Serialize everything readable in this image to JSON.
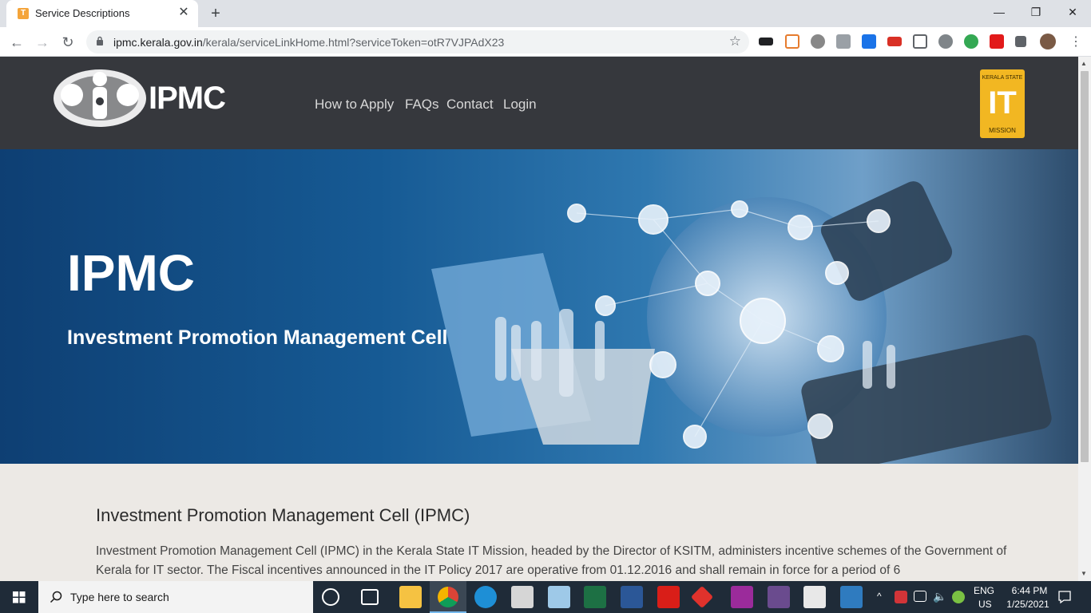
{
  "browser": {
    "tab_title": "Service Descriptions",
    "tab_favicon_letter": "T",
    "tab_close": "✕",
    "new_tab": "+",
    "minimize": "—",
    "restore": "❐",
    "close": "✕",
    "back": "←",
    "forward": "→",
    "reload": "↻",
    "url_host": "ipmc.kerala.gov.in",
    "url_path": "/kerala/serviceLinkHome.html?serviceToken=otR7VJPAdX23",
    "bookmark_star": "☆"
  },
  "site": {
    "logo_text": "IPMC",
    "nav": [
      "How to Apply",
      "FAQs",
      "Contact",
      "Login"
    ],
    "ksitm_logo": {
      "top": "KERALA STATE",
      "mid": "IT",
      "bottom": "MISSION"
    }
  },
  "hero": {
    "title": "IPMC",
    "subtitle": "Investment Promotion Management Cell"
  },
  "content": {
    "heading": "Investment Promotion Management Cell (IPMC)",
    "paragraph": "Investment Promotion Management Cell (IPMC) in the Kerala State IT Mission, headed by the Director of KSITM, administers incentive schemes of the Government of Kerala for IT sector. The Fiscal incentives announced in the IT Policy 2017 are operative from 01.12.2016 and shall remain in force for a period of 6"
  },
  "taskbar": {
    "search_placeholder": "Type here to search",
    "lang_top": "ENG",
    "lang_bottom": "US",
    "time": "6:44 PM",
    "date": "1/25/2021"
  },
  "colors": {
    "header_bg": "#36383d",
    "hero_blue": "#165a94",
    "content_bg": "#ece9e5",
    "ksitm_yellow": "#f2b722"
  }
}
